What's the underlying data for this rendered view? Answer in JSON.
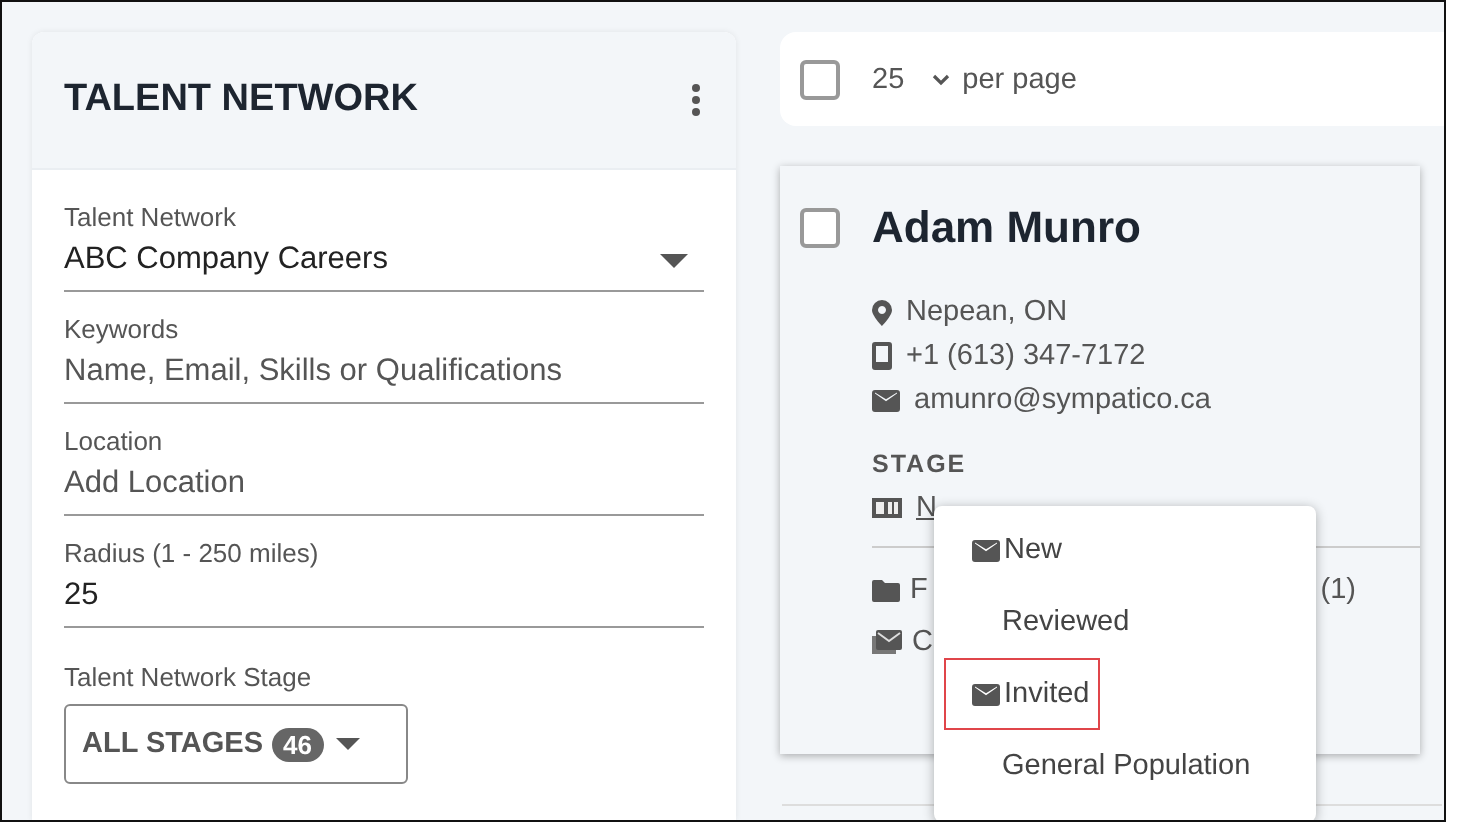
{
  "panel": {
    "title": "TALENT NETWORK",
    "fields": [
      {
        "kind": "select",
        "label": "Talent Network",
        "value": "ABC Company Careers"
      },
      {
        "kind": "text",
        "label": "Keywords",
        "placeholder": "Name, Email, Skills or Qualifications"
      },
      {
        "kind": "text",
        "label": "Location",
        "placeholder": "Add Location"
      },
      {
        "kind": "text",
        "label": "Radius (1 - 250 miles)",
        "value": "25"
      }
    ],
    "stage_filter": {
      "label": "Talent Network Stage",
      "value": "ALL STAGES",
      "count": "46"
    }
  },
  "toolbar": {
    "checked": false,
    "per_page": "25",
    "per_page_label": "per page"
  },
  "candidate": {
    "checked": false,
    "name": "Adam Munro",
    "location": "Nepean, ON",
    "phone": "+1 (613) 347-7172",
    "email": "amunro@sympatico.ca",
    "stage_label": "STAGE",
    "stage_value": "N",
    "rows": [
      {
        "kind": "folder",
        "text": "F",
        "count": "(1)"
      },
      {
        "kind": "campaign",
        "text": "C"
      }
    ]
  },
  "stage_menu": {
    "items": [
      {
        "kind": "mail",
        "label": "New",
        "selected": false
      },
      {
        "kind": "plain",
        "label": "Reviewed",
        "selected": false
      },
      {
        "kind": "mail",
        "label": "Invited",
        "selected": true
      },
      {
        "kind": "plain",
        "label": "General Population",
        "selected": false
      }
    ]
  }
}
